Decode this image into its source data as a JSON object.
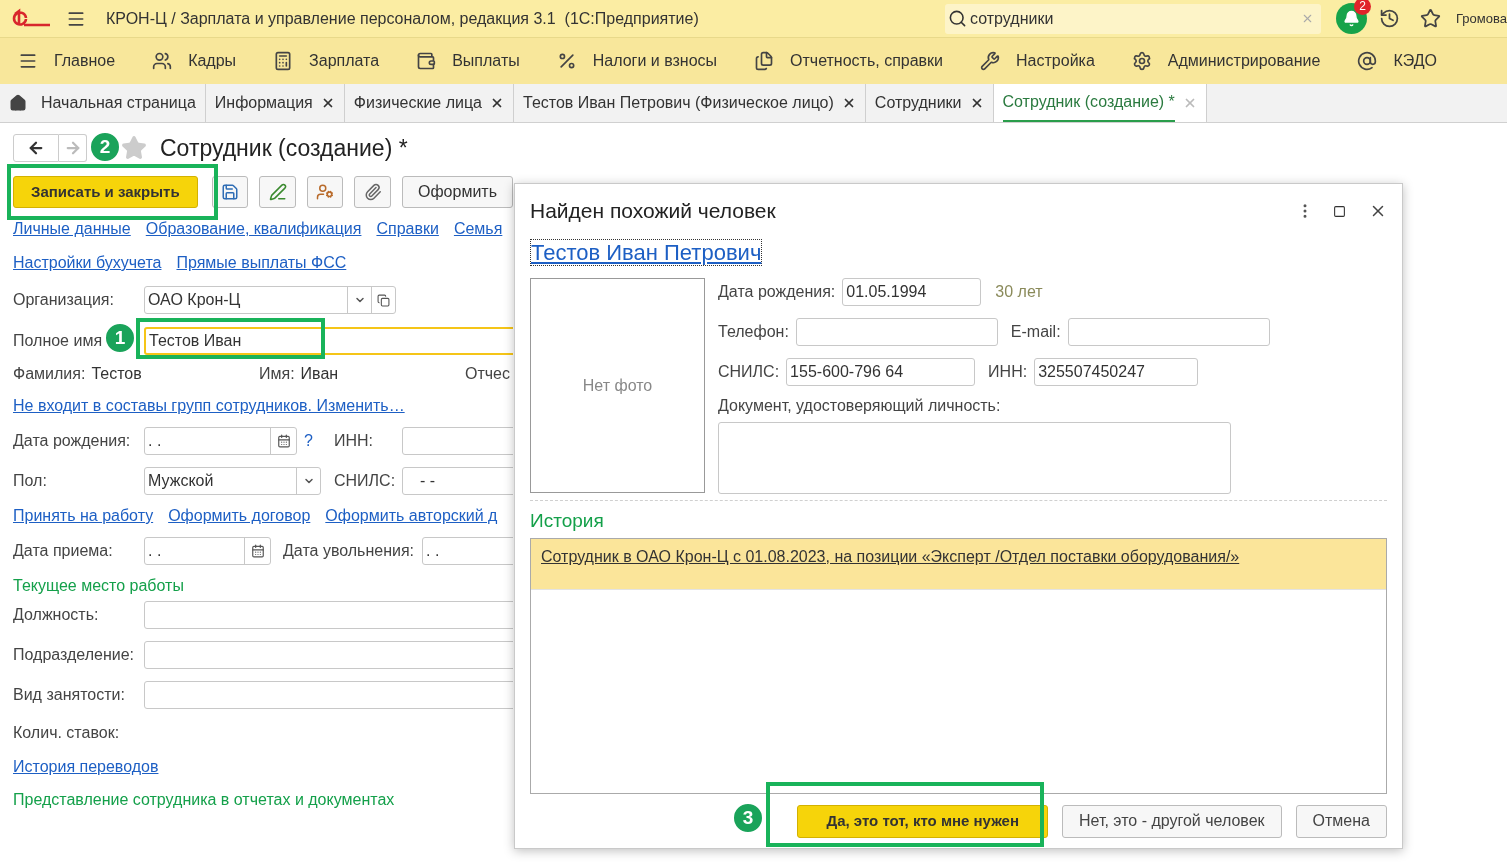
{
  "app_header": {
    "title": "КРОН-Ц / Зарплата и управление персоналом, редакция 3.1  (1С:Предприятие)",
    "search": {
      "value": "сотрудники"
    },
    "notifications_count": "2",
    "user": "Громова"
  },
  "sections": [
    {
      "label": "Главное"
    },
    {
      "label": "Кадры"
    },
    {
      "label": "Зарплата"
    },
    {
      "label": "Выплаты"
    },
    {
      "label": "Налоги и взносы"
    },
    {
      "label": "Отчетность, справки"
    },
    {
      "label": "Настройка"
    },
    {
      "label": "Администрирование"
    },
    {
      "label": "КЭДО"
    }
  ],
  "tabs": [
    {
      "label": "Начальная страница",
      "selected": false,
      "closable": false
    },
    {
      "label": "Информация",
      "selected": false,
      "closable": true
    },
    {
      "label": "Физические лица",
      "selected": false,
      "closable": true
    },
    {
      "label": "Тестов Иван Петрович (Физическое лицо)",
      "selected": false,
      "closable": true
    },
    {
      "label": "Сотрудники",
      "selected": false,
      "closable": true
    },
    {
      "label": "Сотрудник (создание) *",
      "selected": true,
      "closable": true
    }
  ],
  "form": {
    "title": "Сотрудник (создание) *",
    "favorite": false,
    "primary_button": "Записать и закрыть",
    "more_button": "Оформить",
    "link_rows": [
      [
        "Личные данные",
        "Образование, квалификация",
        "Справки",
        "Семья"
      ],
      [
        "Настройки бухучета",
        "Прямые выплаты ФСС"
      ]
    ],
    "organization": {
      "label": "Организация:",
      "value": "ОАО Крон-Ц"
    },
    "full_name": {
      "label": "Полное имя",
      "value": "Тестов Иван"
    },
    "name_parts": [
      {
        "label": "Фамилия:",
        "value": "Тестов"
      },
      {
        "label": "Имя:",
        "value": "Иван"
      },
      {
        "label": "Отчес"
      }
    ],
    "groups_link": "Не входит в составы групп сотрудников. Изменить…",
    "birth_date": {
      "label": "Дата рождения:",
      "value": ".  .",
      "help": "?"
    },
    "inn": {
      "label": "ИНН:"
    },
    "gender": {
      "label": "Пол:",
      "value": "Мужской"
    },
    "snils": {
      "label": "СНИЛС:",
      "value": "-   -"
    },
    "hire_links": [
      "Принять на работу",
      "Оформить договор",
      "Оформить авторский д"
    ],
    "hire_date": {
      "label": "Дата приема:",
      "value": ".  ."
    },
    "dismissal_date": {
      "label": "Дата увольнения:",
      "value": ".  ."
    },
    "current_job_heading": "Текущее место работы",
    "job_fields": [
      {
        "label": "Должность:"
      },
      {
        "label": "Подразделение:"
      },
      {
        "label": "Вид занятости:"
      }
    ],
    "rate_label": "Колич. ставок:",
    "transfers_link": "История переводов",
    "representation_heading": "Представление сотрудника в отчетах и документах"
  },
  "dialog": {
    "title": "Найден похожий человек",
    "person_link": "Тестов Иван Петрович",
    "photo_placeholder": "Нет фото",
    "birth_date": {
      "label": "Дата рождения:",
      "value": "01.05.1994",
      "age": "30 лет"
    },
    "phone": {
      "label": "Телефон:"
    },
    "email": {
      "label": "E-mail:"
    },
    "snils": {
      "label": "СНИЛС:",
      "value": "155-600-796 64"
    },
    "inn": {
      "label": "ИНН:",
      "value": "325507450247"
    },
    "document": {
      "label": "Документ, удостоверяющий личность:"
    },
    "history_heading": "История",
    "history_rows": [
      {
        "text": "Сотрудник в ОАО Крон-Ц с 01.08.2023, на позиции «Эксперт /Отдел поставки оборудования/»",
        "selected": true
      }
    ],
    "buttons": [
      {
        "label": "Да, это тот, кто мне нужен",
        "kind": "primary"
      },
      {
        "label": "Нет, это - другой человек",
        "kind": "default"
      },
      {
        "label": "Отмена",
        "kind": "default"
      }
    ]
  },
  "annotations": [
    {
      "number": "1"
    },
    {
      "number": "2"
    },
    {
      "number": "3"
    }
  ]
}
